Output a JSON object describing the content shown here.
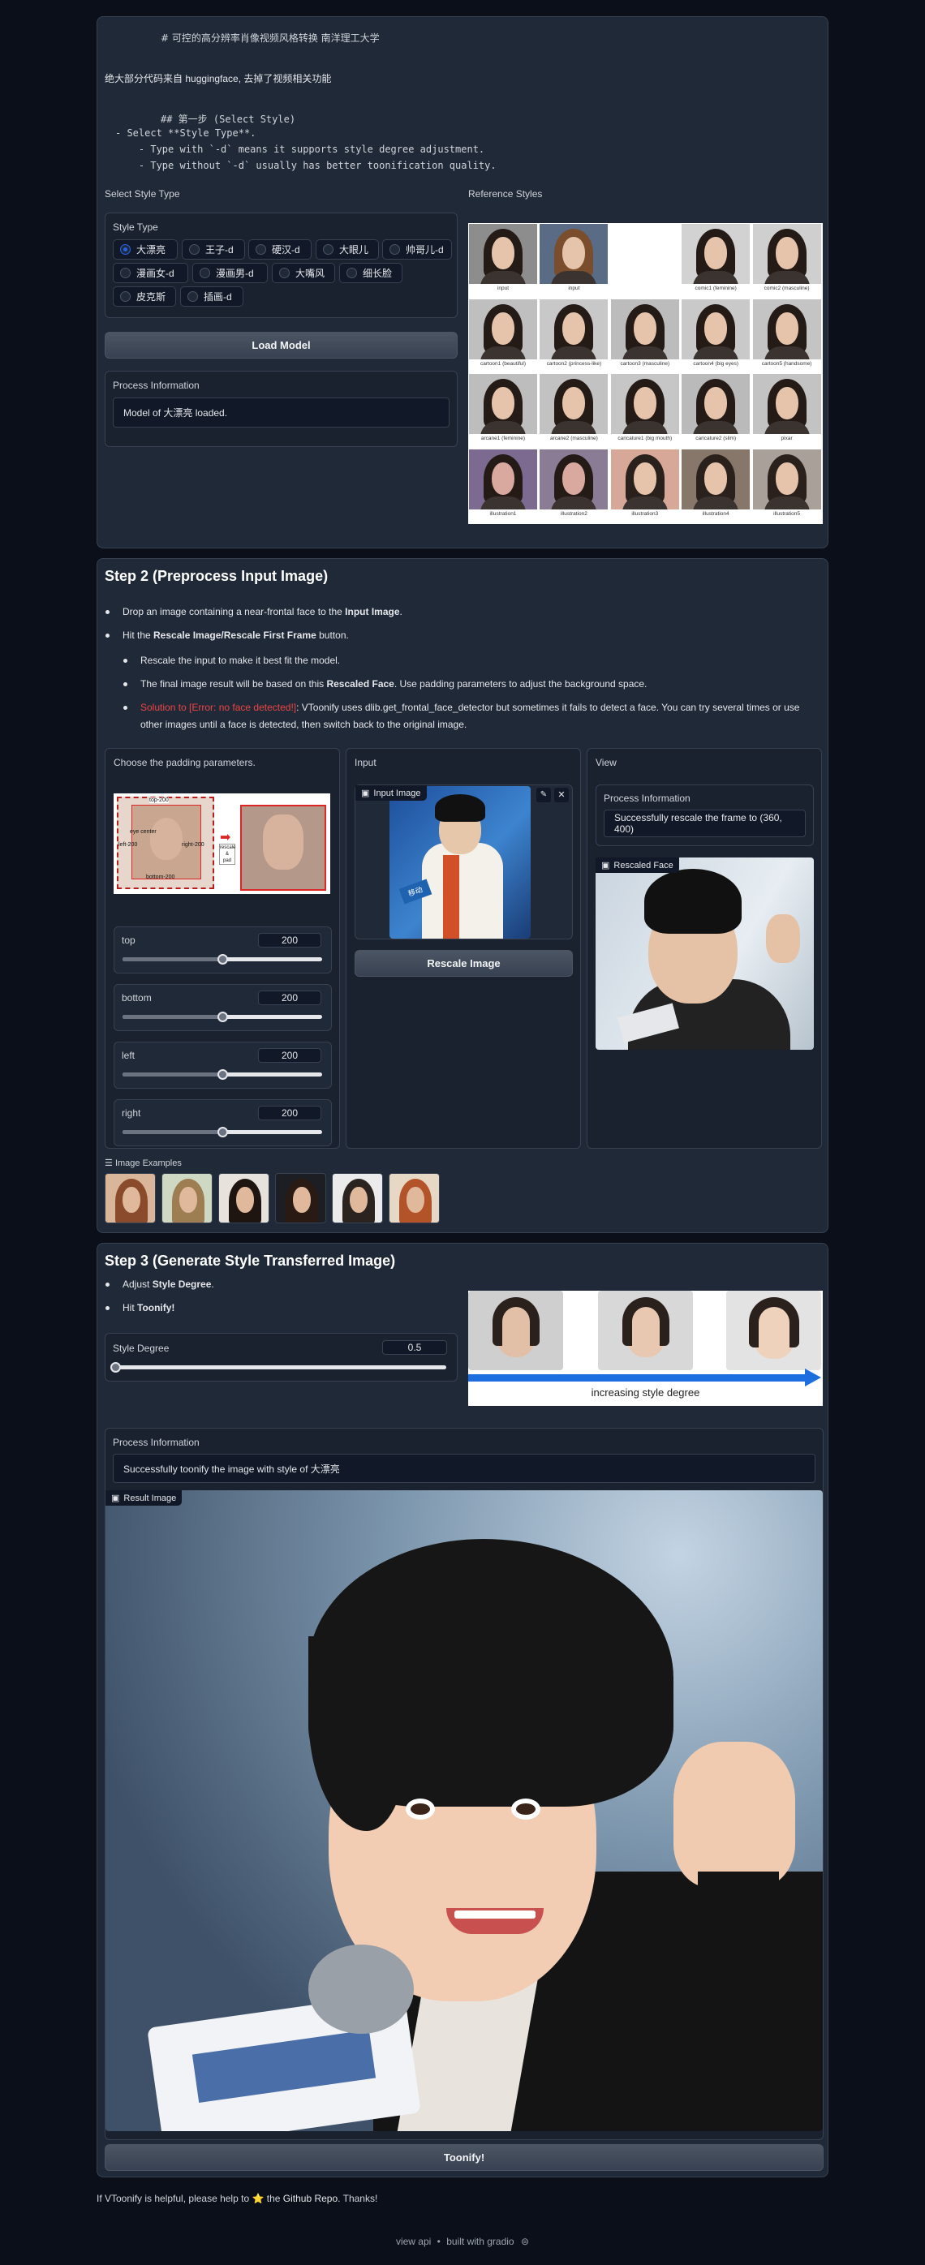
{
  "header": {
    "title": "# 可控的高分辨率肖像视频风格转换 南洋理工大学",
    "source_prefix": "绝大部分代码来自 ",
    "source_link": "huggingface",
    "source_suffix": ", 去掉了视频相关功能",
    "md_lines": [
      "## 第一步 (Select Style)",
      "- Select **Style Type**.",
      "    - Type with `-d` means it supports style degree adjustment.",
      "    - Type without `-d` usually has better toonification quality."
    ]
  },
  "step1": {
    "select_style_label": "Select Style Type",
    "style_type_label": "Style Type",
    "styles": [
      "大漂亮",
      "王子-d",
      "硬汉-d",
      "大眼儿",
      "帅哥儿-d",
      "漫画女-d",
      "漫画男-d",
      "大嘴风",
      "细长脸",
      "皮克斯",
      "插画-d"
    ],
    "selected": "大漂亮",
    "load_button": "Load Model",
    "process_label": "Process Information",
    "process_text": "Model of 大漂亮 loaded.",
    "reference_label": "Reference Styles",
    "reference_captions": [
      "input",
      "input",
      "",
      "comic1 (feminine)",
      "comic2 (masculine)",
      "cartoon1 (beautiful)",
      "cartoon2 (princess-like)",
      "cartoon3 (masculine)",
      "cartoon4 (big eyes)",
      "cartoon5 (handsome)",
      "arcane1 (feminine)",
      "arcane2 (masculine)",
      "caricature1 (big mouth)",
      "caricature2 (slim)",
      "pixar",
      "illustration1",
      "illustration2",
      "illustration3",
      "illustration4",
      "illustration5"
    ]
  },
  "step2": {
    "title": "Step 2 (Preprocess Input Image)",
    "b1_pre": "Drop an image containing a near-frontal face to the ",
    "b1_bold": "Input Image",
    "b1_post": ".",
    "b2_pre": "Hit the ",
    "b2_bold": "Rescale Image/Rescale First Frame",
    "b2_post": " button.",
    "s1": "Rescale the input to make it best fit the model.",
    "s2_pre": "The final image result will be based on this ",
    "s2_bold": "Rescaled Face",
    "s2_post": ". Use padding parameters to adjust the background space.",
    "s3_red": "Solution to [Error: no face detected!]",
    "s3_rest": ": VToonify uses dlib.get_frontal_face_detector but sometimes it fails to detect a face. You can try several times or use other images until a face is detected, then switch back to the original image.",
    "padding_label": "Choose the padding parameters.",
    "diagram_labels": [
      "top-200",
      "eye center",
      "left-200",
      "right-200",
      "bottom-200",
      "rescale",
      "&",
      "pad"
    ],
    "sliders": [
      {
        "label": "top",
        "value": "200",
        "fraction": 0.5
      },
      {
        "label": "bottom",
        "value": "200",
        "fraction": 0.5
      },
      {
        "label": "left",
        "value": "200",
        "fraction": 0.5
      },
      {
        "label": "right",
        "value": "200",
        "fraction": 0.5
      }
    ],
    "input_label": "Input",
    "input_tag": "Input Image",
    "rescale_button": "Rescale Image",
    "view_label": "View",
    "view_process_label": "Process Information",
    "view_process_text": "Successfully rescale the frame to (360, 400)",
    "rescaled_tag": "Rescaled Face",
    "examples_label": "Image Examples"
  },
  "step3": {
    "title": "Step 3 (Generate Style Transferred Image)",
    "b1_pre": "Adjust ",
    "b1_bold": "Style Degree",
    "b1_post": ".",
    "b2_pre": "Hit ",
    "b2_bold": "Toonify!",
    "b2_post": "",
    "degree_label": "Style Degree",
    "degree_value": "0.5",
    "degree_fraction": 0,
    "arrow_text": "increasing style degree",
    "process_label": "Process Information",
    "process_text": "Successfully toonify the image with style of 大漂亮",
    "result_tag": "Result Image",
    "toonify_button": "Toonify!"
  },
  "footer": {
    "pre": "If VToonify is helpful, please help to ",
    "star": "⭐",
    "mid": " the ",
    "link": "Github Repo",
    "post": ". Thanks!",
    "api": "view api",
    "sep": "•",
    "built": "built with gradio"
  }
}
